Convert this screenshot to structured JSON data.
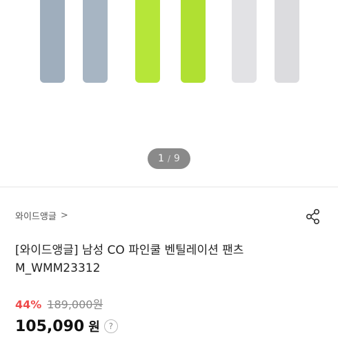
{
  "gallery": {
    "pager": {
      "current": "1",
      "separator": "/",
      "total": "9"
    },
    "colors": {
      "grey": "#9faebd",
      "lime": "#b6e639",
      "white": "#dedede"
    }
  },
  "product": {
    "brand": "와이드앵글",
    "brand_chevron": ">",
    "share_icon": "share-icon",
    "title_line1": "[와이드앵글] 남성 CO 파인쿨 벤틸레이션 팬츠",
    "title_line2": "M_WMM23312",
    "discount": "44%",
    "original_price": "189,000원",
    "final_price": "105,090",
    "currency": "원",
    "help": "?"
  }
}
